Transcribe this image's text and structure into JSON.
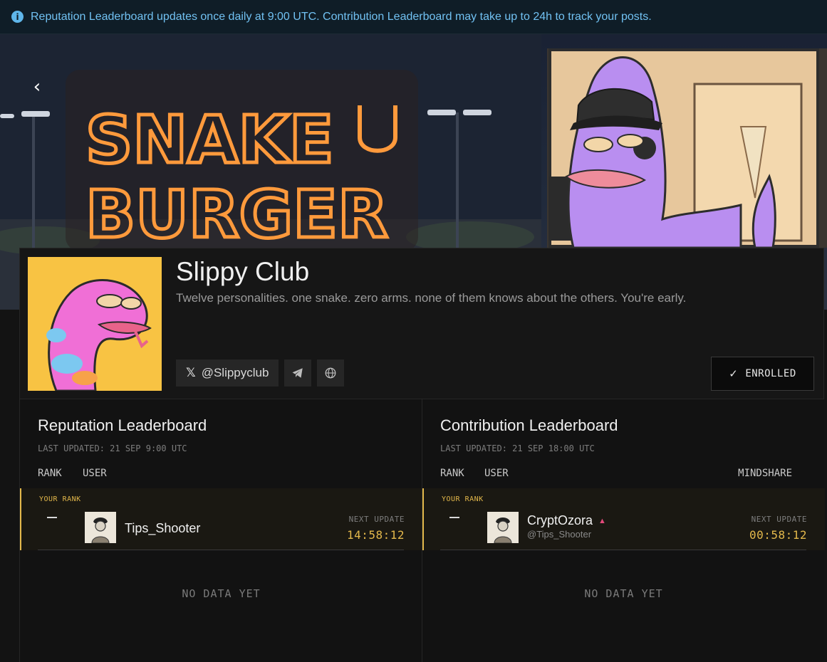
{
  "info_banner": {
    "text": "Reputation Leaderboard updates once daily at 9:00 UTC. Contribution Leaderboard may take up to 24h to track your posts."
  },
  "banner": {
    "neon_line1": "SNAKE",
    "neon_line2": "BURGER",
    "back_icon": "chevron-left-icon"
  },
  "profile": {
    "title": "Slippy Club",
    "description": "Twelve personalities. one snake. zero arms. none of them knows about the others. You're early.",
    "x_handle": "@Slippyclub",
    "enrolled_label": "ENROLLED",
    "icons": [
      "x-logo-icon",
      "telegram-icon",
      "globe-icon",
      "check-icon"
    ]
  },
  "reputation": {
    "title": "Reputation Leaderboard",
    "last_updated": "LAST UPDATED: 21 SEP 9:00 UTC",
    "col_rank": "RANK",
    "col_user": "USER",
    "your_rank_label": "YOUR RANK",
    "rank_value": "—",
    "user_name": "Tips_Shooter",
    "next_update_label": "NEXT UPDATE",
    "next_update_time": "14:58:12",
    "empty_text": "NO DATA YET"
  },
  "contribution": {
    "title": "Contribution Leaderboard",
    "last_updated": "LAST UPDATED: 21 SEP 18:00 UTC",
    "col_rank": "RANK",
    "col_user": "USER",
    "col_mindshare": "MINDSHARE",
    "your_rank_label": "YOUR RANK",
    "rank_value": "—",
    "user_name": "CryptOzora",
    "user_handle": "@Tips_Shooter",
    "next_update_label": "NEXT UPDATE",
    "next_update_time": "00:58:12",
    "empty_text": "NO DATA YET"
  },
  "colors": {
    "accent_gold": "#e3b84b",
    "info_blue": "#71c1f2",
    "avatar_yellow": "#f8c343",
    "trend_pink": "#e2497a"
  }
}
